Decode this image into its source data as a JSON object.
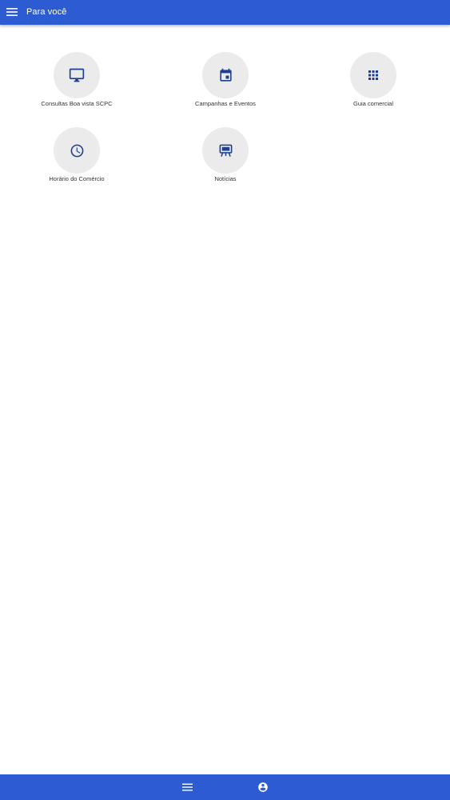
{
  "header": {
    "title": "Para você",
    "menu_icon": "menu-icon"
  },
  "grid": {
    "items": [
      {
        "label": "Consultas Boa vista SCPC",
        "icon": "desktop-icon"
      },
      {
        "label": "Campanhas e Eventos",
        "icon": "calendar-icon"
      },
      {
        "label": "Guia comercial",
        "icon": "apps-grid-icon"
      },
      {
        "label": "Horário do Comércio",
        "icon": "clock-icon"
      },
      {
        "label": "Notícias",
        "icon": "news-easel-icon"
      }
    ]
  },
  "bottom_nav": {
    "items": [
      {
        "icon": "menu-icon"
      },
      {
        "icon": "account-circle-icon"
      }
    ]
  },
  "colors": {
    "primary": "#2d5bd1",
    "icon_blue": "#1e3f8f",
    "circle_bg": "#ebebec",
    "text": "#333333"
  }
}
